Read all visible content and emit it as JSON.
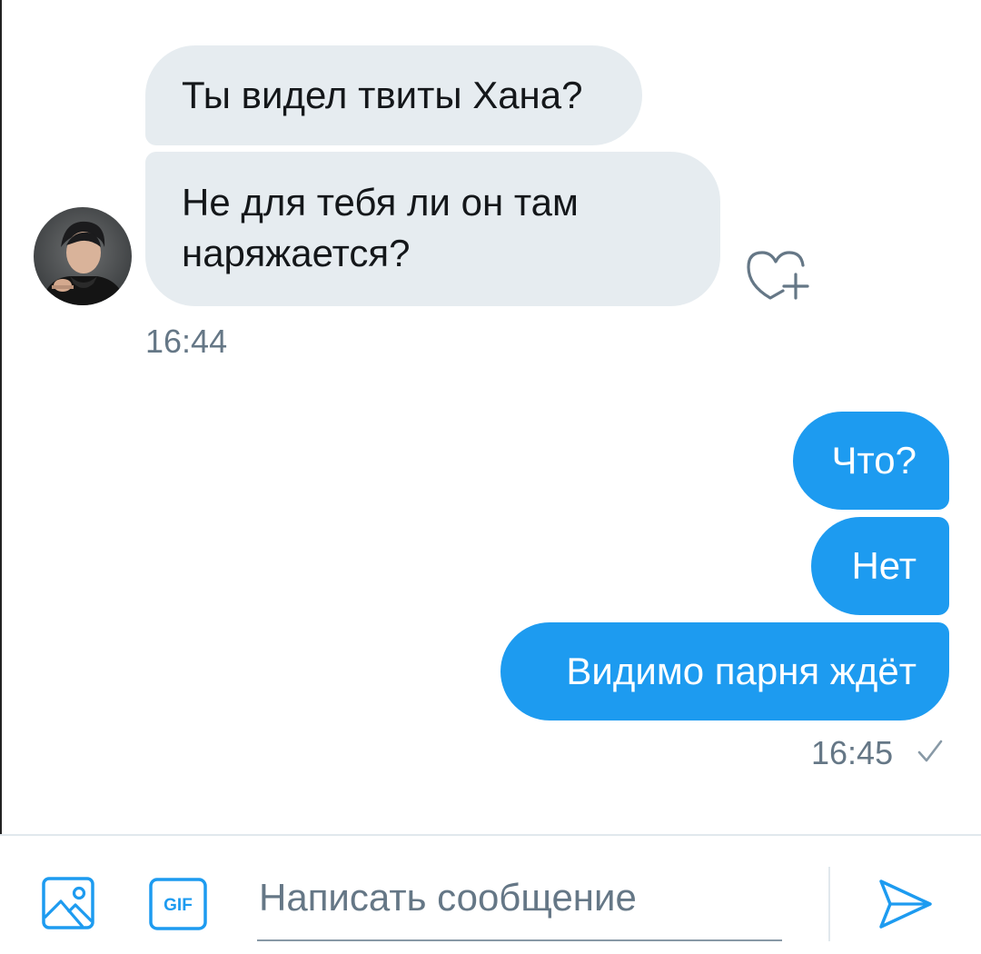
{
  "conversation": {
    "incoming": {
      "messages": [
        "Ты видел твиты Хана?",
        "Не для тебя ли он там наряжается?"
      ],
      "timestamp": "16:44"
    },
    "outgoing": {
      "messages": [
        "Что?",
        "Нет",
        "Видимо парня ждёт"
      ],
      "timestamp": "16:45"
    }
  },
  "composer": {
    "placeholder": "Написать сообщение",
    "gif_label": "GIF"
  },
  "icons": {
    "image": "image-icon",
    "gif": "gif-icon",
    "send": "send-icon",
    "reaction": "heart-plus-icon",
    "sent_status": "checkmark-icon"
  },
  "colors": {
    "accent": "#1d9bf0",
    "incoming_bubble": "#e6ecf0",
    "secondary_text": "#657786"
  }
}
